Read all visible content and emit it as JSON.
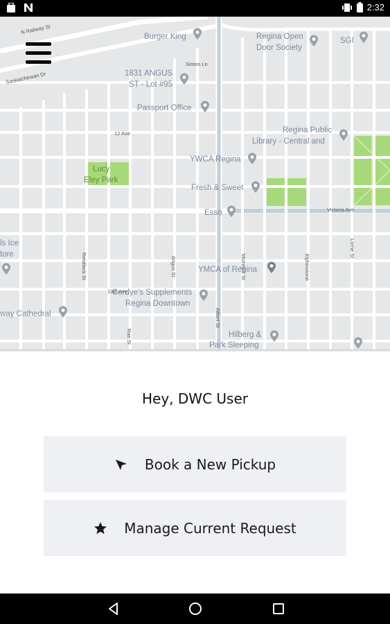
{
  "status_bar": {
    "time": "2:32",
    "left_icons": [
      "briefcase-icon",
      "n-notification-icon"
    ],
    "right_icons": [
      "vibrate-icon",
      "battery-icon"
    ]
  },
  "map": {
    "labels": {
      "north_railway": "N Railway St",
      "burger_king": "Burger King",
      "regina_open_door_1": "Regina Open",
      "regina_open_door_2": "Door Society",
      "sgi": "SGI",
      "saskatchewan_dr": "Saskatchewan Dr",
      "angus_1": "1831 ANGUS",
      "angus_2": "ST - Lot #95",
      "sinton_ln": "Sinton Ln",
      "passport_office": "Passport Office",
      "ave_12": "12 Ave",
      "library_1": "Regina Public",
      "library_2": "Library - Central and",
      "ymca_regina": "YWCA Regina",
      "lucy_1": "Lucy",
      "lucy_2": "Eley Park",
      "fresh_sweet": "Fresh & Sweet",
      "esso": "Esso",
      "victoria_ave": "Victoria Ave",
      "ice_1": "ls Ice",
      "ice_2": "tore",
      "mcintyre": "McIntyre St",
      "ymca_of_regina": "YMCA of Regina",
      "lorne": "Lorne St",
      "angus_st": "Angus St",
      "retallack": "Retallack St",
      "ave_13": "13th Ave",
      "cordes_1": "Cordye's Supplements",
      "cordes_2": "Regina Downtown",
      "cathedral": "way Cathedral",
      "hilberg_1": "Hilberg &",
      "hilberg_2": "Park Sleeping",
      "albert": "Albert St",
      "rae": "Rae St",
      "elphinstone": "Elphinstone"
    }
  },
  "menu": {
    "icon": "hamburger-menu-icon"
  },
  "greeting": "Hey, DWC User",
  "actions": [
    {
      "label": "Book a New Pickup",
      "icon": "send-arrow-icon"
    },
    {
      "label": "Manage Current Request",
      "icon": "star-icon"
    }
  ],
  "nav_bar": {
    "buttons": [
      "back-icon",
      "home-icon",
      "recents-icon"
    ]
  },
  "colors": {
    "map_bg": "#e5e7e8",
    "road": "#ffffff",
    "major_road": "#c3cfd9",
    "park": "#a7d97a",
    "button_bg": "#eff0f3"
  }
}
